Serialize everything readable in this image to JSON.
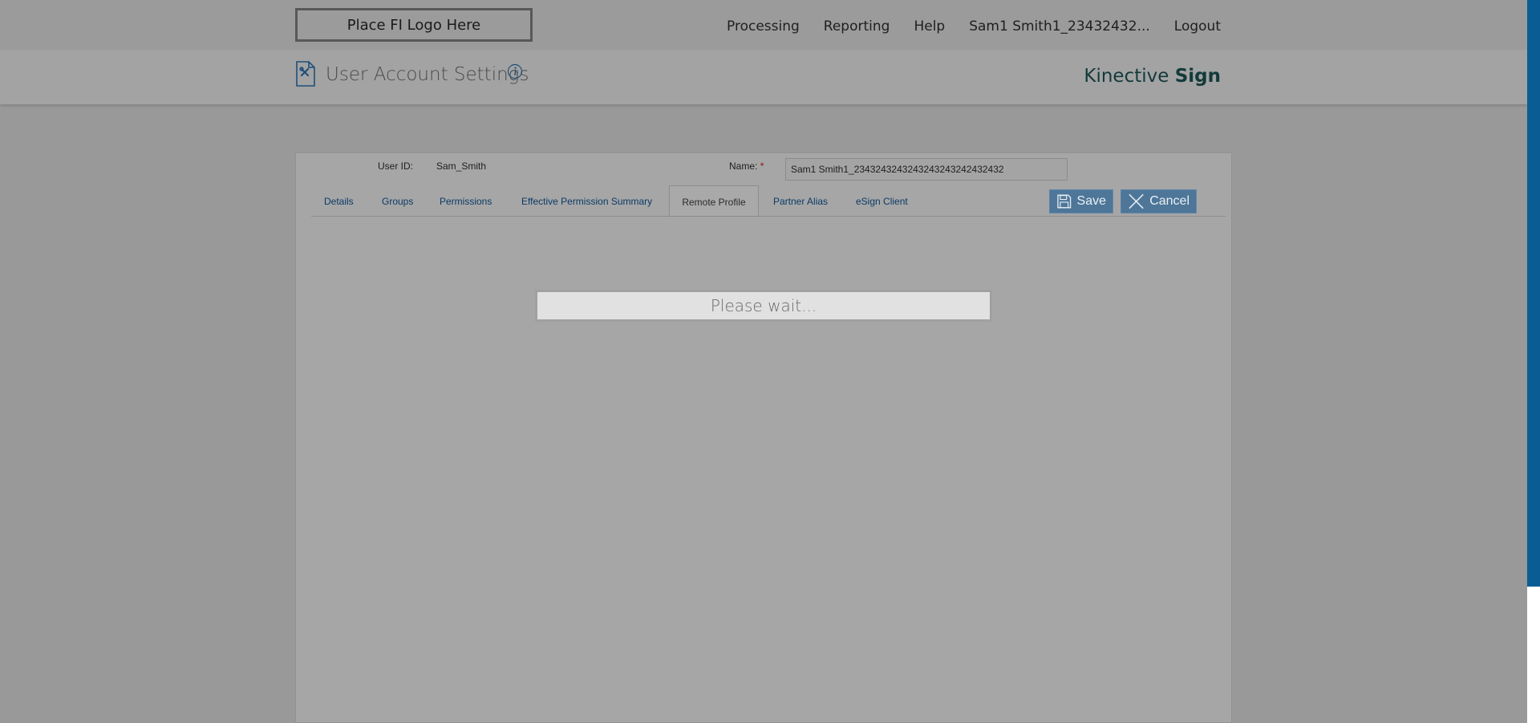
{
  "header": {
    "logo_text": "Place FI Logo Here",
    "nav": [
      "Processing",
      "Reporting",
      "Help",
      "Sam1 Smith1_23432432...",
      "Logout"
    ]
  },
  "page": {
    "title": "User Account Settings",
    "brand_light": "Kinective ",
    "brand_bold": "Sign"
  },
  "form": {
    "user_id_label": "User ID:",
    "user_id_value": "Sam_Smith",
    "name_label": "Name:",
    "name_required_mark": "*",
    "name_value": "Sam1 Smith1_2343243243243243243242432432"
  },
  "tabs": [
    {
      "label": "Details"
    },
    {
      "label": "Groups"
    },
    {
      "label": "Permissions"
    },
    {
      "label": "Effective Permission Summary"
    },
    {
      "label": "Remote Profile",
      "active": true
    },
    {
      "label": "Partner Alias"
    },
    {
      "label": "eSign Client"
    }
  ],
  "actions": {
    "save_label": "Save",
    "cancel_label": "Cancel"
  },
  "overlay": {
    "message": "Please wait..."
  },
  "colors": {
    "accent_bar": "#0a5d94",
    "button_bg": "#4d7699",
    "link": "#0b3b66",
    "brand": "#143a3a"
  },
  "icons": [
    "settings-document-icon",
    "info-icon",
    "floppy-disk-icon",
    "close-icon"
  ]
}
